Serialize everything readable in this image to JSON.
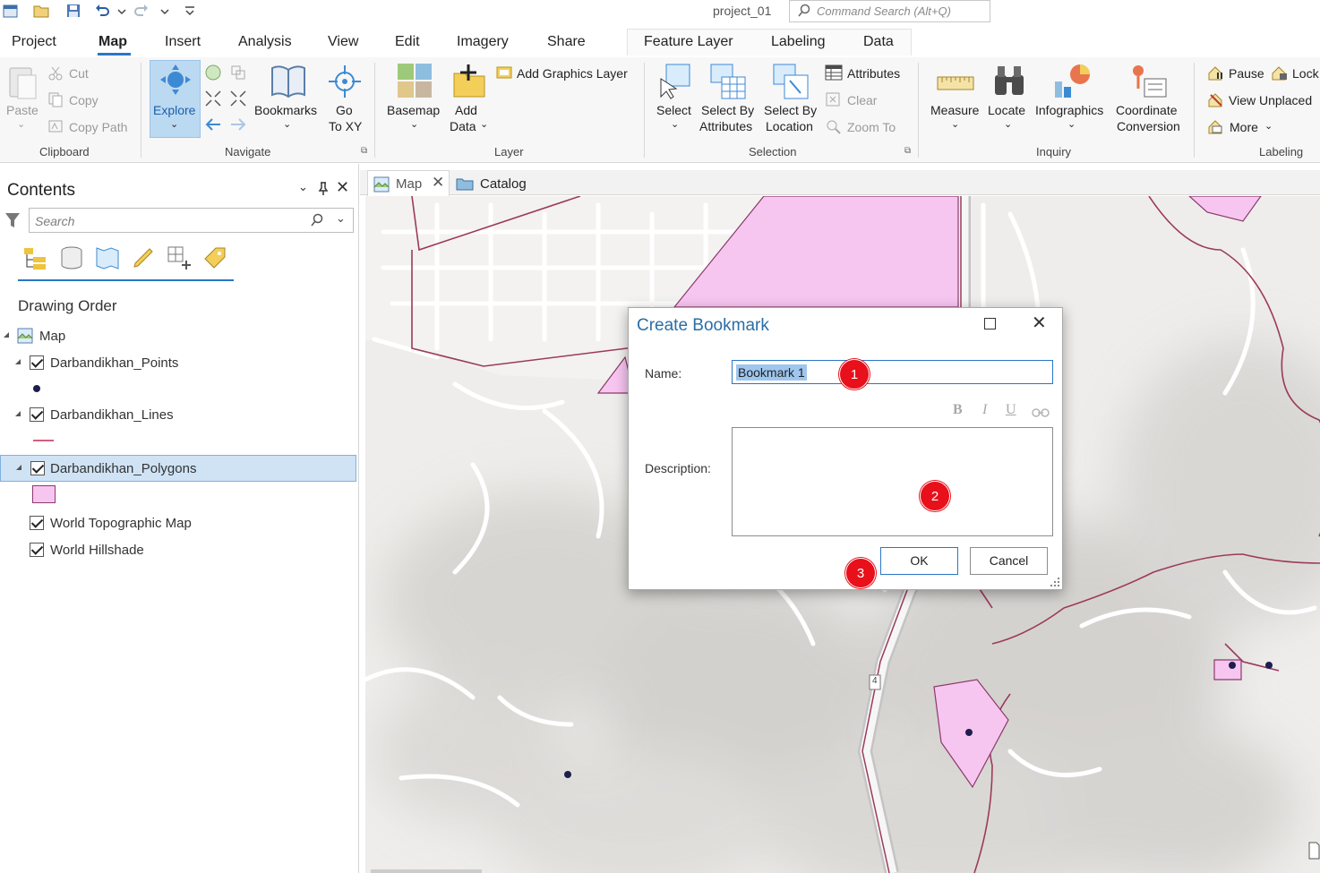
{
  "titlebar": {
    "project": "project_01",
    "command_search_placeholder": "Command Search (Alt+Q)"
  },
  "tabs": [
    "Project",
    "Map",
    "Insert",
    "Analysis",
    "View",
    "Edit",
    "Imagery",
    "Share"
  ],
  "active_tab": "Map",
  "context_tabs": [
    "Feature Layer",
    "Labeling",
    "Data"
  ],
  "ribbon": {
    "clipboard": {
      "paste": "Paste",
      "cut": "Cut",
      "copy": "Copy",
      "copy_path": "Copy Path",
      "group": "Clipboard"
    },
    "navigate": {
      "explore": "Explore",
      "bookmarks": "Bookmarks",
      "go": "Go",
      "to_xy": "To XY",
      "group": "Navigate"
    },
    "layer": {
      "basemap": "Basemap",
      "add": "Add",
      "data": "Data",
      "add_graphics_layer": "Add Graphics Layer",
      "group": "Layer"
    },
    "selection": {
      "select": "Select",
      "select_by": "Select By",
      "attributes_btn": "Attributes",
      "select_by2": "Select By",
      "location": "Location",
      "attributes": "Attributes",
      "clear": "Clear",
      "zoom_to": "Zoom To",
      "group": "Selection"
    },
    "inquiry": {
      "measure": "Measure",
      "locate": "Locate",
      "infographics": "Infographics",
      "coordinate": "Coordinate",
      "conversion": "Conversion",
      "group": "Inquiry"
    },
    "labeling": {
      "pause": "Pause",
      "lock": "Lock",
      "view_unplaced": "View Unplaced",
      "more": "More",
      "group": "Labeling"
    }
  },
  "contents": {
    "title": "Contents",
    "search_placeholder": "Search",
    "section": "Drawing Order",
    "map": "Map",
    "layers": [
      {
        "name": "Darbandikhan_Points",
        "checked": true
      },
      {
        "name": "Darbandikhan_Lines",
        "checked": true
      },
      {
        "name": "Darbandikhan_Polygons",
        "checked": true,
        "selected": true
      },
      {
        "name": "World Topographic Map",
        "checked": true
      },
      {
        "name": "World Hillshade",
        "checked": true
      }
    ]
  },
  "map_tabs": [
    "Map",
    "Catalog"
  ],
  "map_labels": {
    "route": "4"
  },
  "dialog": {
    "title": "Create Bookmark",
    "name_label": "Name:",
    "name_value": "Bookmark 1",
    "description_label": "Description:",
    "format": {
      "bold": "B",
      "italic": "I",
      "underline": "U"
    },
    "ok": "OK",
    "cancel": "Cancel"
  },
  "steps": [
    "1",
    "2",
    "3"
  ],
  "colors": {
    "accent": "#2a76c6",
    "polygon_fill": "#f7c6f0",
    "polygon_stroke": "#8a3a6a",
    "line": "#9c3a5c",
    "step_badge": "#e8101a"
  }
}
